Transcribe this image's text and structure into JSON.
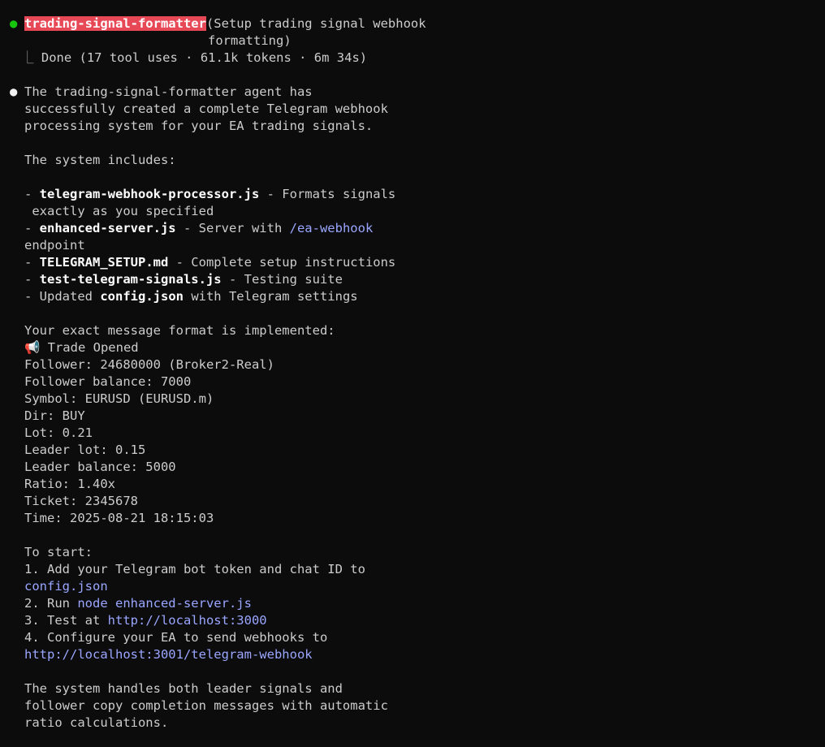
{
  "agent": {
    "name": "trading-signal-formatter",
    "desc_line1": "(Setup trading signal webhook",
    "desc_line2": "formatting)",
    "connector": "⎿",
    "status": "Done (17 tool uses · 61.1k tokens · 6m 34s)"
  },
  "intro": [
    "The trading-signal-formatter agent has",
    "successfully created a complete Telegram webhook",
    "processing system for your EA trading signals."
  ],
  "includes_heading": "The system includes:",
  "files": {
    "f1_prefix": "- ",
    "f1_name": "telegram-webhook-processor.js",
    "f1_desc": " - Formats signals",
    "f1_cont": " exactly as you specified",
    "f2_prefix": "- ",
    "f2_name": "enhanced-server.js",
    "f2_desc": " - Server with ",
    "f2_link": "/ea-webhook",
    "f2_cont": "endpoint",
    "f3_prefix": "- ",
    "f3_name": "TELEGRAM_SETUP.md",
    "f3_desc": " - Complete setup instructions",
    "f4_prefix": "- ",
    "f4_name": "test-telegram-signals.js",
    "f4_desc": " - Testing suite",
    "f5_prefix": "- Updated ",
    "f5_name": "config.json",
    "f5_desc": " with Telegram settings"
  },
  "format_heading": "Your exact message format is implemented:",
  "format": {
    "icon": "📢",
    "lines": [
      " Trade Opened",
      "Follower: 24680000 (Broker2-Real)",
      "Follower balance: 7000",
      "Symbol: EURUSD (EURUSD.m)",
      "Dir: BUY",
      "Lot: 0.21",
      "Leader lot: 0.15",
      "Leader balance: 5000",
      "Ratio: 1.40x",
      "Ticket: 2345678",
      "Time: 2025-08-21 18:15:03"
    ]
  },
  "start": {
    "heading": "To start:",
    "s1": "1. Add your Telegram bot token and chat ID to",
    "s1_link": "config.json",
    "s2_prefix": "2. Run ",
    "s2_link": "node enhanced-server.js",
    "s3_prefix": "3. Test at ",
    "s3_link": "http://localhost:3000",
    "s4": "4. Configure your EA to send webhooks to",
    "s4_link": "http://localhost:3001/telegram-webhook"
  },
  "outro": [
    "The system handles both leader signals and",
    "follower copy completion messages with automatic",
    "ratio calculations."
  ],
  "colors": {
    "background": "#0c0c0c",
    "text": "#cccccc",
    "bullet_green": "#16c60c",
    "agent_highlight": "#e74856",
    "link": "#9aa6ff"
  }
}
